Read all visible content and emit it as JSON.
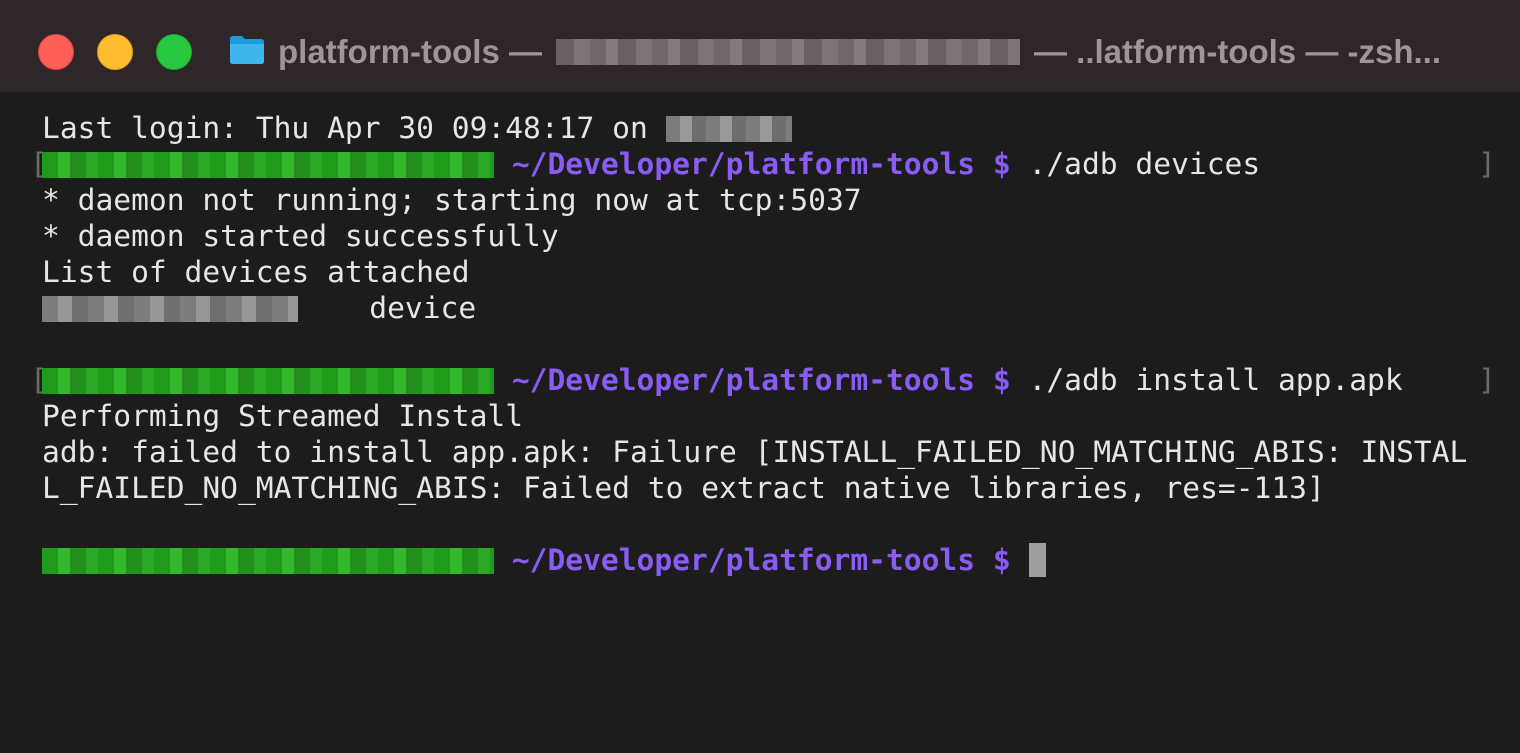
{
  "window": {
    "title_app": "platform-tools —",
    "title_rest": "— ..latform-tools — -zsh..."
  },
  "terminal": {
    "last_login": "Last login: Thu Apr 30 09:48:17 on ",
    "prompt_path": "~/Developer/platform-tools $",
    "cmd1": "./adb devices",
    "out1": "* daemon not running; starting now at tcp:5037",
    "out2": "* daemon started successfully",
    "out3": "List of devices attached",
    "device_state": "device",
    "cmd2": "./adb install app.apk",
    "out4": "Performing Streamed Install",
    "out5": "adb: failed to install app.apk: Failure [INSTALL_FAILED_NO_MATCHING_ABIS: INSTAL",
    "out6": "L_FAILED_NO_MATCHING_ABIS: Failed to extract native libraries, res=-113]",
    "bracket_open": "[",
    "bracket_close": "]"
  },
  "colors": {
    "path": "#8a5cf5",
    "user": "#2ba826",
    "text": "#e6e6e6",
    "background": "#1c1c1c"
  }
}
